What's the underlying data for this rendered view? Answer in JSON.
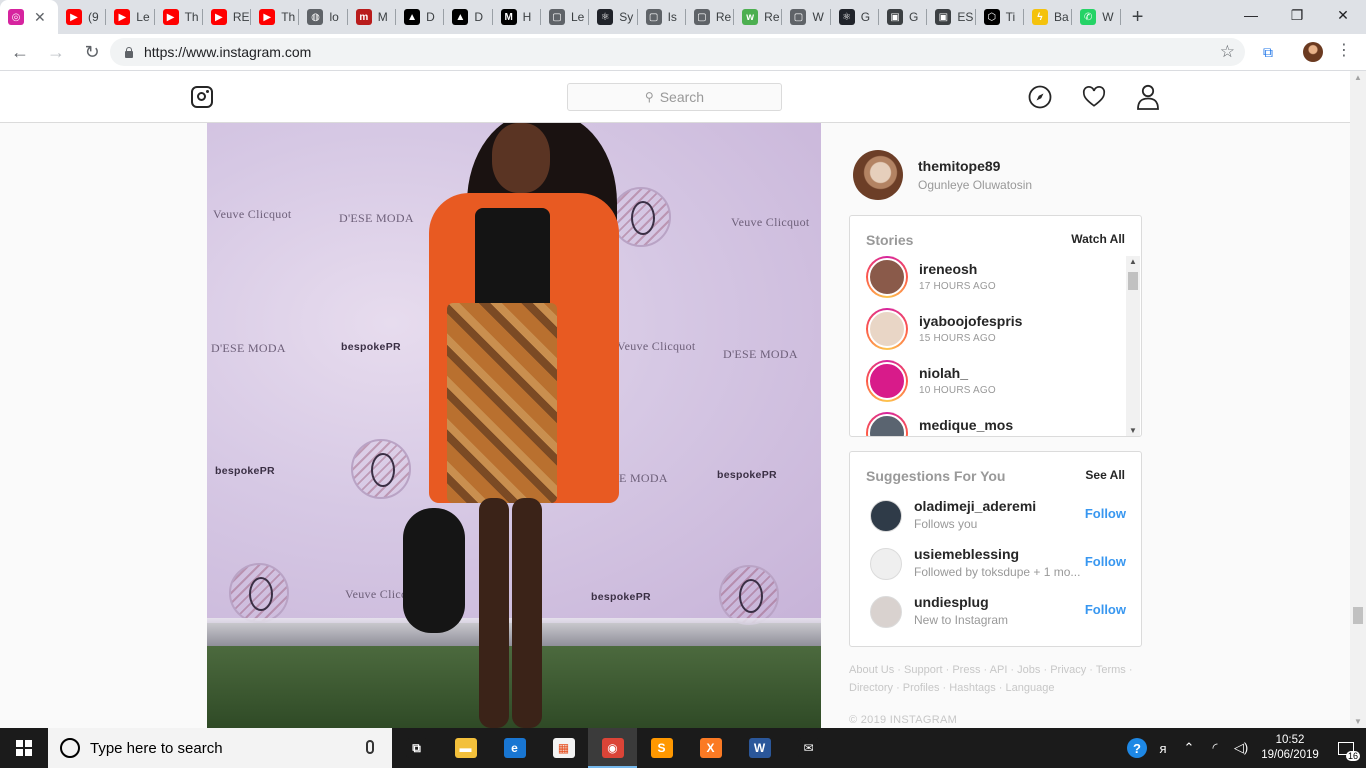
{
  "browser": {
    "tabs": [
      {
        "favicon": "instagram-icon",
        "label": "",
        "color": "#d6249f",
        "glyph": "◎",
        "active": true
      },
      {
        "favicon": "youtube-icon",
        "label": "(9",
        "color": "#ff0000",
        "glyph": "▶"
      },
      {
        "favicon": "youtube-icon",
        "label": "Le",
        "color": "#ff0000",
        "glyph": "▶"
      },
      {
        "favicon": "youtube-icon",
        "label": "Th",
        "color": "#ff0000",
        "glyph": "▶"
      },
      {
        "favicon": "youtube-icon",
        "label": "RE",
        "color": "#ff0000",
        "glyph": "▶"
      },
      {
        "favicon": "youtube-icon",
        "label": "Th",
        "color": "#ff0000",
        "glyph": "▶"
      },
      {
        "favicon": "globe-icon",
        "label": "lo",
        "color": "#5f6368",
        "glyph": "◍"
      },
      {
        "favicon": "m-icon",
        "label": "M",
        "color": "#b91c1c",
        "glyph": "m"
      },
      {
        "favicon": "triangle-icon",
        "label": "D",
        "color": "#000000",
        "glyph": "▲"
      },
      {
        "favicon": "triangle-icon",
        "label": "D",
        "color": "#000000",
        "glyph": "▲"
      },
      {
        "favicon": "medium-icon",
        "label": "H",
        "color": "#000000",
        "glyph": "M"
      },
      {
        "favicon": "doc-icon",
        "label": "Le",
        "color": "#5f6368",
        "glyph": "▢"
      },
      {
        "favicon": "react-icon",
        "label": "Sy",
        "color": "#20232a",
        "glyph": "⚛"
      },
      {
        "favicon": "doc-icon",
        "label": "Is",
        "color": "#5f6368",
        "glyph": "▢"
      },
      {
        "favicon": "doc-icon",
        "label": "Re",
        "color": "#5f6368",
        "glyph": "▢"
      },
      {
        "favicon": "w3-icon",
        "label": "Re",
        "color": "#4caf50",
        "glyph": "w"
      },
      {
        "favicon": "doc-icon",
        "label": "W",
        "color": "#5f6368",
        "glyph": "▢"
      },
      {
        "favicon": "react-icon",
        "label": "G",
        "color": "#20232a",
        "glyph": "⚛"
      },
      {
        "favicon": "floppy-icon",
        "label": "G",
        "color": "#3c4043",
        "glyph": "▣"
      },
      {
        "favicon": "floppy-icon",
        "label": "ES",
        "color": "#3c4043",
        "glyph": "▣"
      },
      {
        "favicon": "hex-icon",
        "label": "Ti",
        "color": "#000000",
        "glyph": "⬡"
      },
      {
        "favicon": "bolt-icon",
        "label": "Ba",
        "color": "#f4c20d",
        "glyph": "ϟ"
      },
      {
        "favicon": "whatsapp-icon",
        "label": "W",
        "color": "#25d366",
        "glyph": "✆"
      }
    ],
    "new_tab_glyph": "+",
    "url": "https://www.instagram.com"
  },
  "instagram": {
    "search_placeholder": "Search",
    "post_image": {
      "backdrop_text": {
        "veuve": "Veuve Clicquot",
        "dese": "D'ESE MODA",
        "bespoke": "bespokePR"
      }
    },
    "profile": {
      "username": "themitope89",
      "full_name": "Ogunleye Oluwatosin"
    },
    "stories": {
      "title": "Stories",
      "action": "Watch All",
      "items": [
        {
          "username": "ireneosh",
          "time": "17 HOURS AGO",
          "avatar_color": "#8a5a4a"
        },
        {
          "username": "iyaboojofespris",
          "time": "15 HOURS AGO",
          "avatar_color": "#e9d6c6"
        },
        {
          "username": "niolah_",
          "time": "10 HOURS AGO",
          "avatar_color": "#d81b8a"
        },
        {
          "username": "medique_mos",
          "time": "",
          "avatar_color": "#5a6470"
        }
      ]
    },
    "suggestions": {
      "title": "Suggestions For You",
      "action": "See All",
      "items": [
        {
          "username": "oladimeji_aderemi",
          "subtitle": "Follows you",
          "button": "Follow",
          "avatar_color": "#2f3b48"
        },
        {
          "username": "usiemeblessing",
          "subtitle": "Followed by toksdupe + 1 mo...",
          "button": "Follow",
          "avatar_color": "#efefef"
        },
        {
          "username": "undiesplug",
          "subtitle": "New to Instagram",
          "button": "Follow",
          "avatar_color": "#d9d2cf"
        }
      ]
    },
    "footer_links": [
      "About Us",
      "Support",
      "Press",
      "API",
      "Jobs",
      "Privacy",
      "Terms",
      "Directory",
      "Profiles",
      "Hashtags",
      "Language"
    ],
    "copyright": "© 2019 INSTAGRAM"
  },
  "taskbar": {
    "search_placeholder": "Type here to search",
    "apps": [
      {
        "name": "task-view-icon",
        "glyph": "⧉",
        "color": "#1b1b1b"
      },
      {
        "name": "file-explorer-icon",
        "glyph": "▬",
        "color": "#f3c03b"
      },
      {
        "name": "edge-icon",
        "glyph": "e",
        "color": "#1976d2"
      },
      {
        "name": "store-icon",
        "glyph": "▦",
        "color": "#f3f3f3"
      },
      {
        "name": "chrome-icon",
        "glyph": "◉",
        "color": "#db4437",
        "active": true
      },
      {
        "name": "sublime-icon",
        "glyph": "S",
        "color": "#ff9800"
      },
      {
        "name": "xampp-icon",
        "glyph": "X",
        "color": "#fb7a24"
      },
      {
        "name": "word-icon",
        "glyph": "W",
        "color": "#2b579a"
      },
      {
        "name": "mail-icon",
        "glyph": "✉",
        "color": "#1b1b1b"
      }
    ],
    "time": "10:52",
    "date": "19/06/2019",
    "notification_count": "16"
  }
}
